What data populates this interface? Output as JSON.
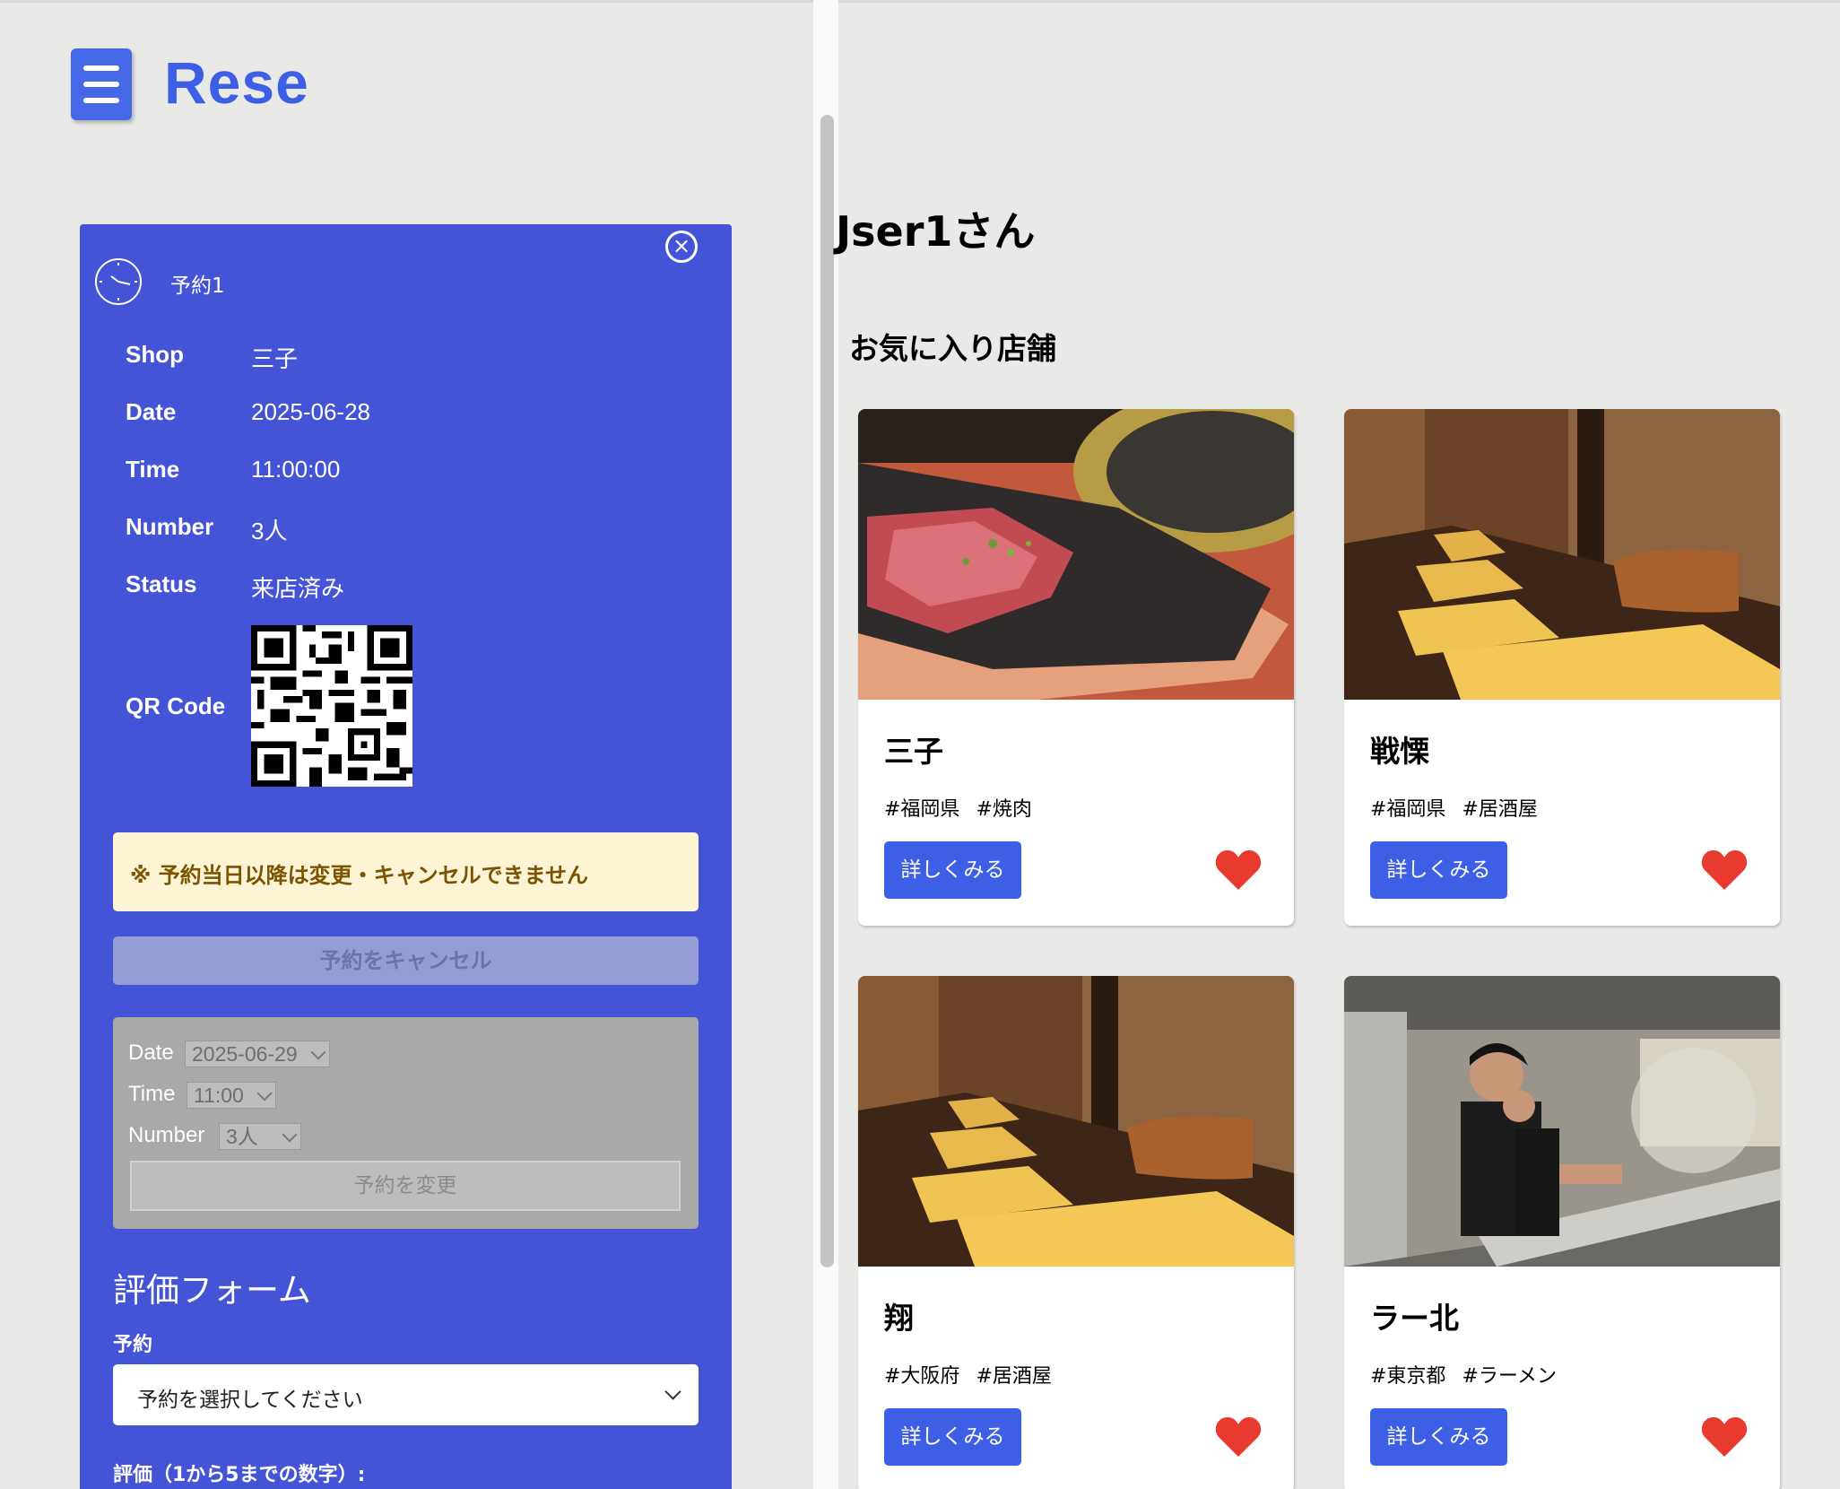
{
  "app": {
    "brand": "Rese"
  },
  "reservation": {
    "title": "予約1",
    "fields": [
      {
        "label": "Shop",
        "value": "三子"
      },
      {
        "label": "Date",
        "value": "2025-06-28"
      },
      {
        "label": "Time",
        "value": "11:00:00"
      },
      {
        "label": "Number",
        "value": "3人"
      },
      {
        "label": "Status",
        "value": "来店済み"
      }
    ],
    "qr_label": "QR Code",
    "warning": "※ 予約当日以降は変更・キャンセルできません",
    "cancel_label": "予約をキャンセル",
    "change": {
      "date_label": "Date",
      "date_value": "2025-06-29",
      "time_label": "Time",
      "time_value": "11:00",
      "number_label": "Number",
      "number_value": "3人",
      "submit_label": "予約を変更"
    }
  },
  "review": {
    "title": "評価フォーム",
    "reservation_label": "予約",
    "reservation_placeholder": "予約を選択してください",
    "rating_label": "評価（1から5までの数字）:"
  },
  "user": {
    "greeting": "Jser1さん"
  },
  "favorites": {
    "heading": "お気に入り店舗",
    "detail_label": "詳しくみる",
    "shops": [
      {
        "name": "三子",
        "tags": [
          "#福岡県",
          "#焼肉"
        ]
      },
      {
        "name": "戦慄",
        "tags": [
          "#福岡県",
          "#居酒屋"
        ]
      },
      {
        "name": "翔",
        "tags": [
          "#大阪府",
          "#居酒屋"
        ]
      },
      {
        "name": "ラー北",
        "tags": [
          "#東京都",
          "#ラーメン"
        ]
      }
    ]
  },
  "colors": {
    "accent": "#3d5fe5",
    "card": "#4454d6",
    "heart": "#e83a2f"
  }
}
